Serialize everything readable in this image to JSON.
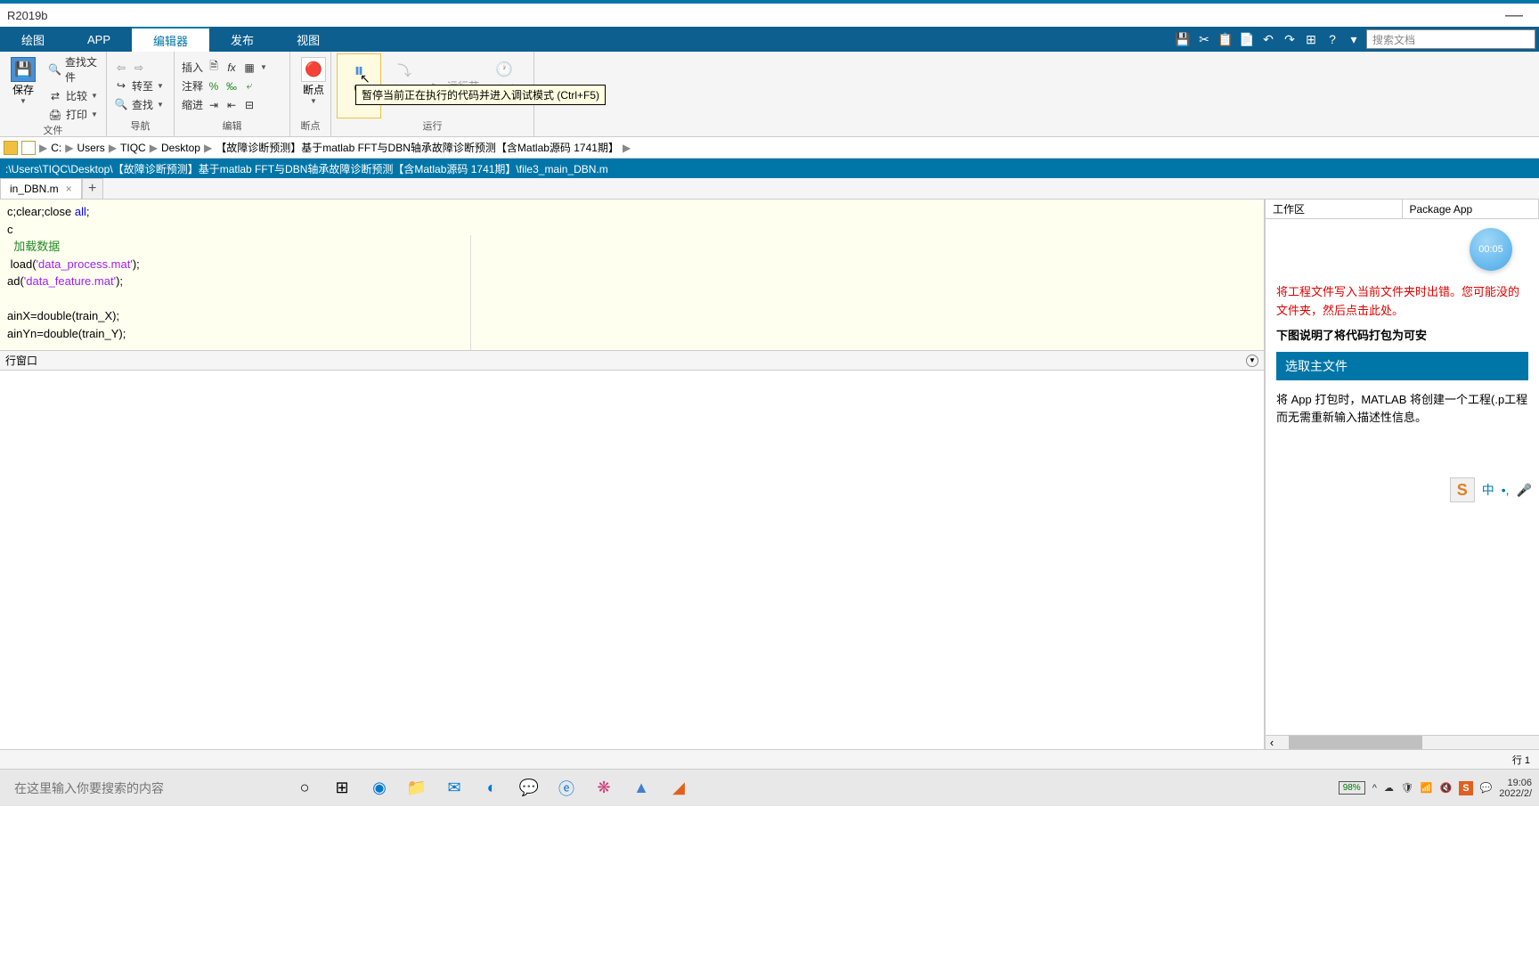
{
  "title": "R2019b",
  "tabs": [
    "绘图",
    "APP",
    "编辑器",
    "发布",
    "视图"
  ],
  "active_tab": 2,
  "search_placeholder": "搜索文档",
  "ribbon": {
    "file": {
      "save": "保存",
      "find_files": "查找文件",
      "compare": "比较",
      "print": "打印",
      "label": "文件"
    },
    "nav": {
      "goto": "转至",
      "find": "查找",
      "label": "导航"
    },
    "edit": {
      "insert": "插入",
      "comment": "注释",
      "indent": "缩进",
      "label": "编辑"
    },
    "breakpoints": {
      "label": "断点",
      "btn": "断点"
    },
    "run": {
      "pause": "暂",
      "forward": "前进",
      "run_section": "运行节",
      "timer": "计时",
      "label": "运行"
    }
  },
  "tooltip": "暂停当前正在执行的代码并进入调试模式 (Ctrl+F5)",
  "breadcrumbs": [
    "C:",
    "Users",
    "TIQC",
    "Desktop",
    "【故障诊断预测】基于matlab FFT与DBN轴承故障诊断预测【含Matlab源码 1741期】"
  ],
  "editor_path": ":\\Users\\TIQC\\Desktop\\【故障诊断预测】基于matlab FFT与DBN轴承故障诊断预测【含Matlab源码 1741期】\\file3_main_DBN.m",
  "file_tab": "in_DBN.m",
  "code": {
    "l1a": "c;clear;close ",
    "l1b": "all",
    "l1c": ";",
    "l2": "c",
    "l3": "  加载数据",
    "l4a": " load(",
    "l4b": "'data_process.mat'",
    "l4c": ");",
    "l5a": "ad(",
    "l5b": "'data_feature.mat'",
    "l5c": ");",
    "l6": "ainX=double(train_X);",
    "l7": "ainYn=double(train_Y);"
  },
  "cmdwin_title": "行窗口",
  "right_tabs": [
    "工作区",
    "Package App"
  ],
  "timer": "00:05",
  "pkg": {
    "error": "将工程文件写入当前文件夹时出错。您可能没的文件夹，然后点击此处。",
    "bold": "下图说明了将代码打包为可安",
    "section": "选取主文件",
    "desc": "将 App 打包时，MATLAB 将创建一个工程(.p工程而无需重新输入描述性信息。"
  },
  "ime_cn": "中",
  "status": "行 1",
  "taskbar": {
    "search": "在这里输入你要搜索的内容",
    "battery": "98%",
    "time": "19:06",
    "date": "2022/2/"
  }
}
